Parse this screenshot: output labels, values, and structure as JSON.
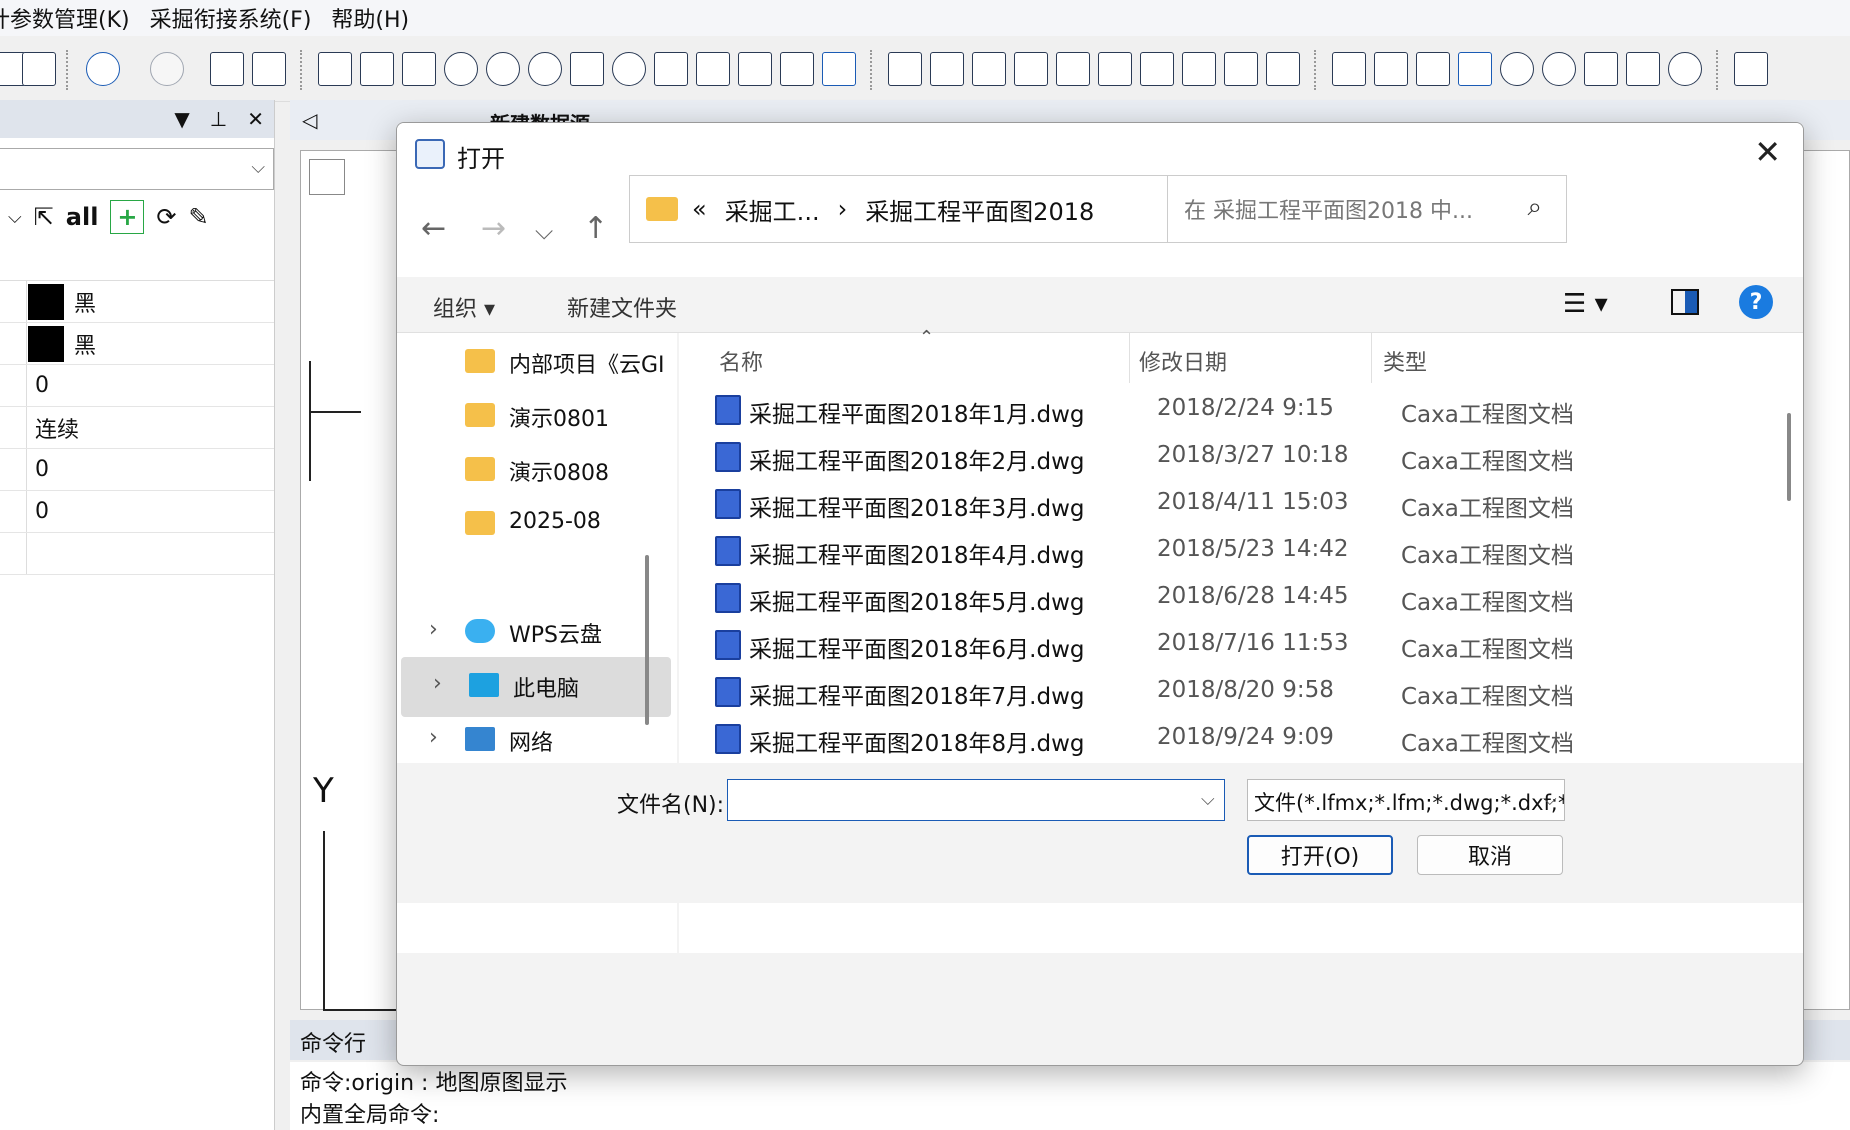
{
  "menubar": {
    "items": [
      "计参数管理(K)",
      "采掘衔接系统(F)",
      "帮助(H)"
    ]
  },
  "left_panel": {
    "tools_all": "all",
    "tools_plus": "+",
    "rows": [
      {
        "type": "swatch",
        "label": "黑"
      },
      {
        "type": "swatch",
        "label": "黑"
      },
      {
        "type": "text",
        "label": "0"
      },
      {
        "type": "text",
        "label": "连续"
      },
      {
        "type": "text",
        "label": "0"
      },
      {
        "type": "text",
        "label": "0"
      }
    ]
  },
  "doc_tab": {
    "label": "新建数据源"
  },
  "canvas": {
    "axis_label": "Y"
  },
  "command": {
    "header": "命令行",
    "lines": [
      "命令:origin : 地图原图显示",
      "内置全局命令:"
    ]
  },
  "dialog": {
    "title": "打开",
    "address": {
      "prefix": "«",
      "crumb1": "采掘工...",
      "crumb_sep": "›",
      "crumb2": "采掘工程平面图2018"
    },
    "search_placeholder": "在 采掘工程平面图2018 中...",
    "toolbar": {
      "organize": "组织 ▾",
      "new_folder": "新建文件夹"
    },
    "nav_items": [
      {
        "label": "内部项目《云GI",
        "icon": "folder-icon"
      },
      {
        "label": "演示0801",
        "icon": "folder-synced-icon"
      },
      {
        "label": "演示0808",
        "icon": "folder-icon"
      },
      {
        "label": "2025-08",
        "icon": "folder-icon"
      },
      {
        "label": "WPS云盘",
        "icon": "cloud-icon"
      },
      {
        "label": "此电脑",
        "icon": "computer-icon"
      },
      {
        "label": "网络",
        "icon": "network-icon"
      }
    ],
    "columns": {
      "name": "名称",
      "date": "修改日期",
      "type": "类型"
    },
    "files": [
      {
        "name": "采掘工程平面图2018年1月.dwg",
        "date": "2018/2/24 9:15",
        "type": "Caxa工程图文档"
      },
      {
        "name": "采掘工程平面图2018年2月.dwg",
        "date": "2018/3/27 10:18",
        "type": "Caxa工程图文档"
      },
      {
        "name": "采掘工程平面图2018年3月.dwg",
        "date": "2018/4/11 15:03",
        "type": "Caxa工程图文档"
      },
      {
        "name": "采掘工程平面图2018年4月.dwg",
        "date": "2018/5/23 14:42",
        "type": "Caxa工程图文档"
      },
      {
        "name": "采掘工程平面图2018年5月.dwg",
        "date": "2018/6/28 14:45",
        "type": "Caxa工程图文档"
      },
      {
        "name": "采掘工程平面图2018年6月.dwg",
        "date": "2018/7/16 11:53",
        "type": "Caxa工程图文档"
      },
      {
        "name": "采掘工程平面图2018年7月.dwg",
        "date": "2018/8/20 9:58",
        "type": "Caxa工程图文档"
      },
      {
        "name": "采掘工程平面图2018年8月.dwg",
        "date": "2018/9/24 9:09",
        "type": "Caxa工程图文档"
      }
    ],
    "filename_label": "文件名(N):",
    "filename_value": "",
    "filetype_value": "文件(*.lfmx;*.lfm;*.dwg;*.dxf;*.",
    "open_button": "打开(O)",
    "cancel_button": "取消"
  },
  "colors": {
    "accent": "#1a5bb5",
    "folder": "#f5c04a",
    "selected": "#dcdcdc"
  }
}
